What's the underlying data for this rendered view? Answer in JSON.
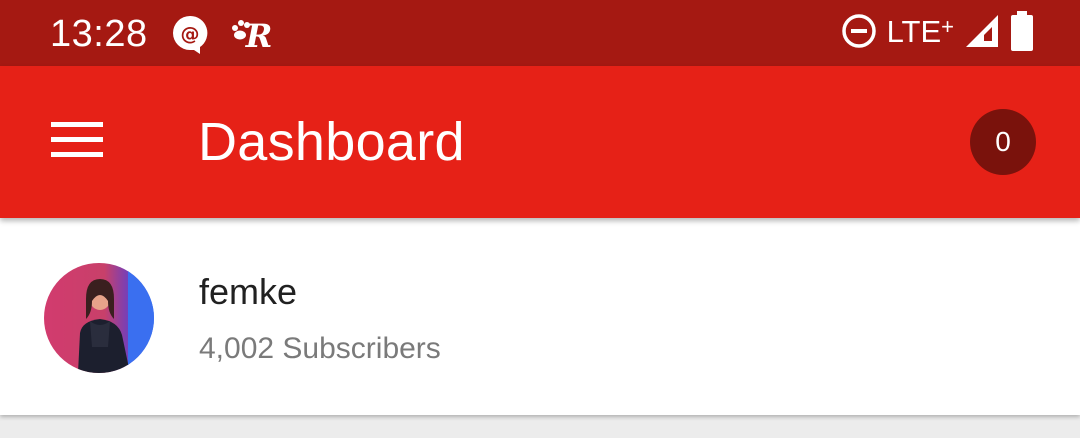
{
  "status_bar": {
    "time": "13:28",
    "notification_icons": [
      "at-sign-chat-icon",
      "paw-r-app-icon"
    ],
    "dnd_icon": "do-not-disturb-icon",
    "network_label": "LTE",
    "network_plus": "+",
    "signal_icon": "cell-signal-icon",
    "battery_icon": "battery-icon"
  },
  "app_bar": {
    "menu_icon": "hamburger-menu-icon",
    "title": "Dashboard",
    "badge_count": "0",
    "color": "#e62117"
  },
  "channel": {
    "name": "femke",
    "subscribers": "4,002 Subscribers",
    "avatar": "channel-avatar"
  },
  "colors": {
    "status_bar": "#a51912",
    "app_bar": "#e62117",
    "badge": "#7a120c",
    "background": "#ececec"
  }
}
